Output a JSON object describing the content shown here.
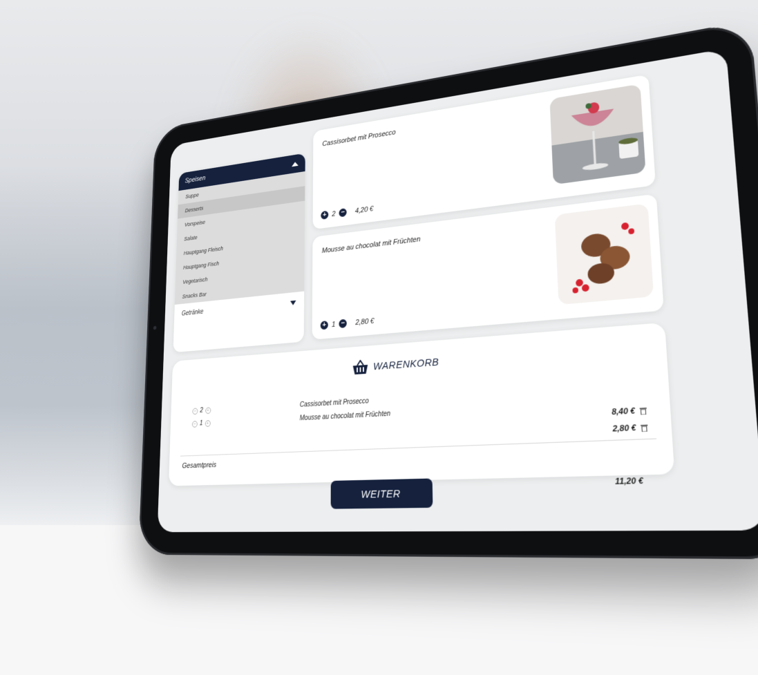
{
  "menu": {
    "header": "Speisen",
    "items": [
      {
        "label": "Suppe"
      },
      {
        "label": "Desserts"
      },
      {
        "label": "Vorspeise"
      },
      {
        "label": "Salate"
      },
      {
        "label": "Hauptgang Fleisch"
      },
      {
        "label": "Hauptgang Fisch"
      },
      {
        "label": "Vegetarisch"
      },
      {
        "label": "Snacks Bar"
      }
    ],
    "selected_index": 1,
    "footer": "Getränke"
  },
  "products": [
    {
      "name": "Cassisorbet mit Prosecco",
      "plus": "+",
      "minus": "−",
      "qty": "2",
      "price": "4,20 €",
      "image": "cocktail-glass-photo"
    },
    {
      "name": "Mousse au chocolat mit Früchten",
      "plus": "+",
      "minus": "−",
      "qty": "1",
      "price": "2,80 €",
      "image": "chocolate-mousse-photo"
    }
  ],
  "cart": {
    "title": "WARENKORB",
    "items": [
      {
        "plus": "+",
        "minus": "−",
        "qty": "2",
        "name": "Cassisorbet mit Prosecco",
        "price": "8,40 €"
      },
      {
        "plus": "+",
        "minus": "−",
        "qty": "1",
        "name": "Mousse au chocolat mit Früchten",
        "price": "2,80 €"
      }
    ],
    "total_label": "Gesamtpreis",
    "total_value": "11,20 €"
  },
  "actions": {
    "continue_label": "WEITER"
  },
  "colors": {
    "primary": "#15213d",
    "screen_bg": "#eceeef",
    "bezel": "#0e0f11"
  }
}
